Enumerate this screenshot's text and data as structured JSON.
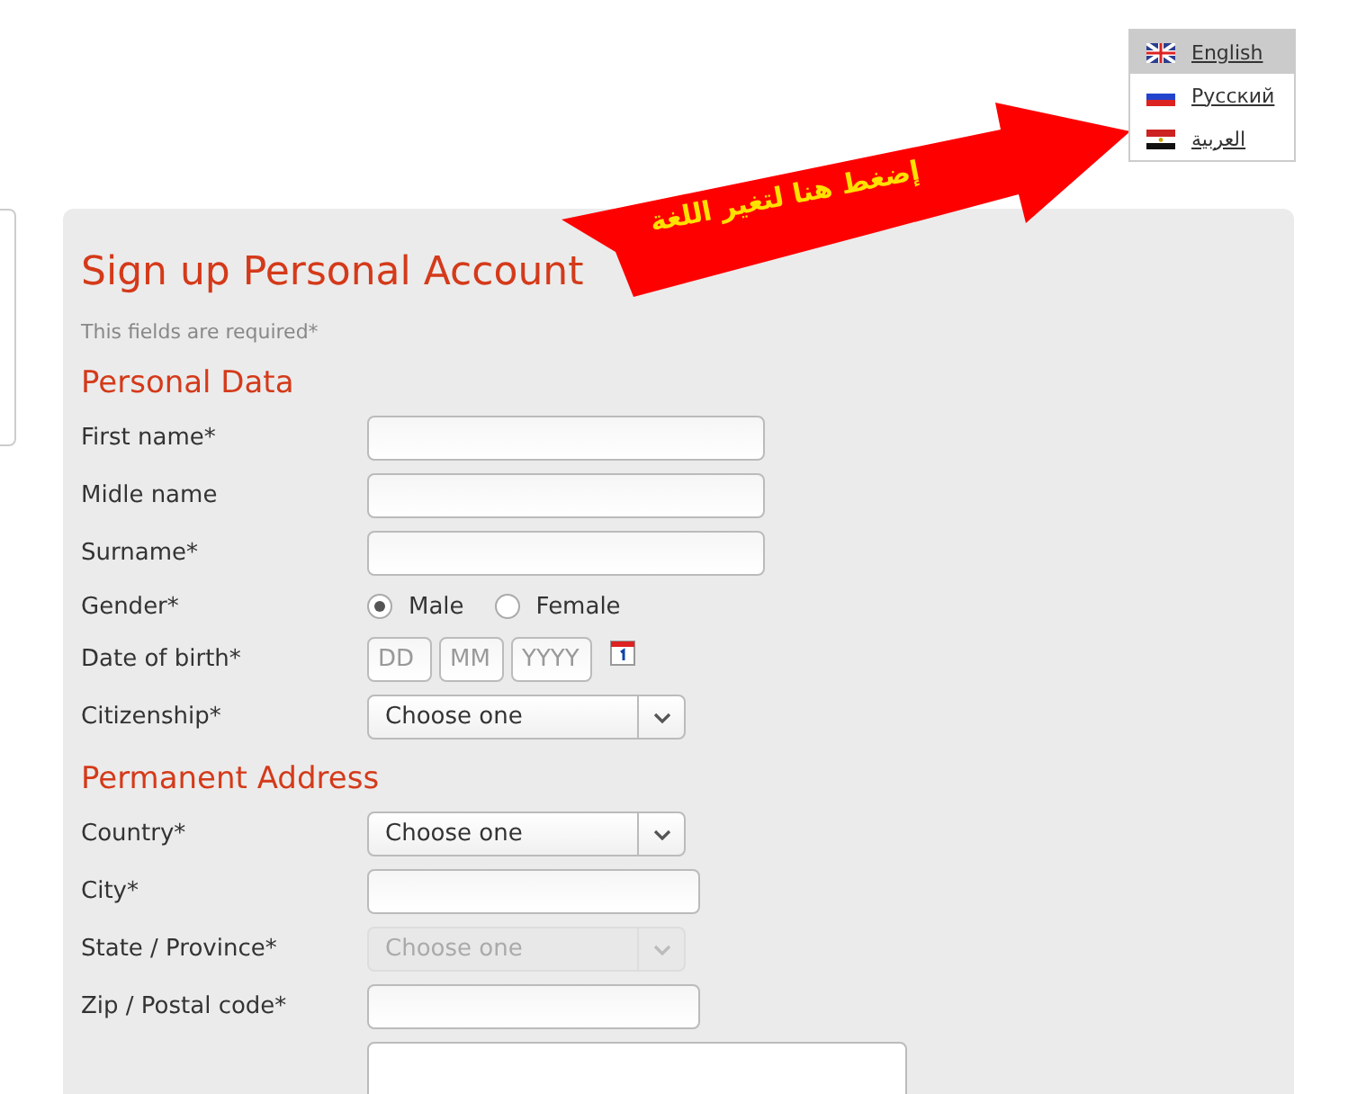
{
  "language_menu": [
    {
      "label": "English",
      "kind": "uk",
      "selected": true
    },
    {
      "label": "Русский",
      "kind": "ru",
      "selected": false
    },
    {
      "label": "العربية",
      "kind": "eg",
      "selected": false
    }
  ],
  "callout": {
    "text": "إضغط هنا لتغير اللغة"
  },
  "form": {
    "title": "Sign up Personal Account",
    "note": "This fields are required*",
    "sections": [
      {
        "heading": "Personal Data",
        "fields": [
          {
            "kind": "text",
            "label": "First name*"
          },
          {
            "kind": "text",
            "label": "Midle name"
          },
          {
            "kind": "text",
            "label": "Surname*"
          },
          {
            "kind": "radio",
            "label": "Gender*",
            "options": [
              {
                "label": "Male",
                "selected": true
              },
              {
                "label": "Female",
                "selected": false
              }
            ]
          },
          {
            "kind": "date",
            "label": "Date of birth*",
            "placeholders": [
              "DD",
              "MM",
              "YYYY"
            ]
          },
          {
            "kind": "select",
            "label": "Citizenship*",
            "value": "Choose one",
            "disabled": false
          }
        ]
      },
      {
        "heading": "Permanent Address",
        "fields": [
          {
            "kind": "select",
            "label": "Country*",
            "value": "Choose one",
            "disabled": false
          },
          {
            "kind": "short_text",
            "label": "City*"
          },
          {
            "kind": "select",
            "label": "State / Province*",
            "value": "Choose one",
            "disabled": true
          },
          {
            "kind": "short_text",
            "label": "Zip / Postal code*"
          },
          {
            "kind": "textarea"
          }
        ]
      }
    ]
  }
}
